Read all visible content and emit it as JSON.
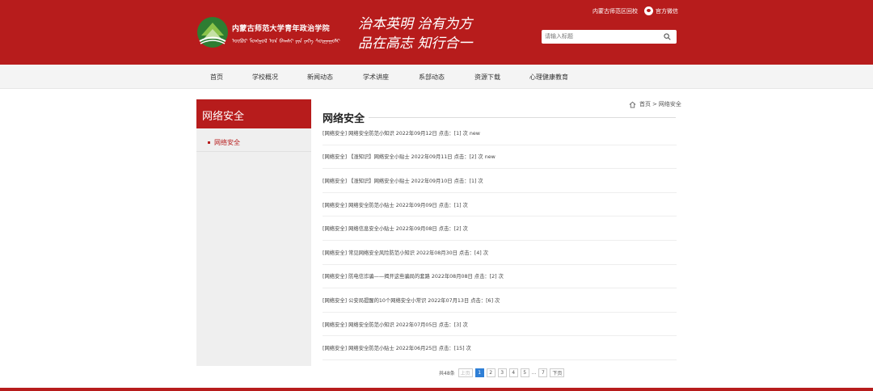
{
  "header": {
    "school_name_cn": "内蒙古师范大学青年政治学院",
    "school_name_mn": "ᠥᠪᠥᠷ ᠮᠣᠩᠭᠣᠯ ᠤᠨ ᠪᠠᠭᠰᠢ ᠶᠢᠨ ᠶᠡᠬᠡ ᠰᠤᠷᠭᠠᠭᠤᠯᠢ",
    "motto_line1": "治本英明 治有为方",
    "motto_line2": "品在高志 知行合一",
    "top_link": "内蒙古师范区回校",
    "wechat_label": "官方微信",
    "search_placeholder": "请输入标题"
  },
  "nav": {
    "items": [
      "首页",
      "学校概况",
      "新闻动态",
      "学术讲座",
      "系部动态",
      "资源下载",
      "心理健康教育"
    ]
  },
  "sidebar": {
    "title": "网络安全",
    "items": [
      "网络安全"
    ]
  },
  "breadcrumb": {
    "home": "首页",
    "sep": ">",
    "current": "网络安全"
  },
  "main": {
    "title": "网络安全",
    "articles": [
      "[网络安全] 网络安全防范小知识  2022年09月12日  点击：[1] 次 new",
      "[网络安全] 【涨知识】网络安全小贴士  2022年09月11日  点击：[2] 次 new",
      "[网络安全] 【涨知识】网络安全小贴士  2022年09月10日  点击：[1] 次",
      "[网络安全] 网络安全防范小贴士  2022年09月09日  点击：[1] 次",
      "[网络安全] 网络信息安全小贴士  2022年09月08日  点击：[2] 次",
      "[网络安全] 常见网络安全风险防范小知识  2022年08月30日  点击：[4] 次",
      "[网络安全] 防电信诈骗——揭开这些骗局的套路  2022年08月08日  点击：[2] 次",
      "[网络安全] 公安局提醒的10个网络安全小常识  2022年07月13日  点击：[6] 次",
      "[网络安全] 网络安全防范小知识  2022年07月05日  点击：[3] 次",
      "[网络安全] 网络安全防范小贴士  2022年06月25日  点击：[15] 次"
    ]
  },
  "pagination": {
    "total_label": "共48条",
    "prev": "上页",
    "pages": [
      "1",
      "2",
      "3",
      "4",
      "5"
    ],
    "ellipsis": "...",
    "last": "7",
    "next": "下页",
    "current_page": "1"
  },
  "colors": {
    "brand_red": "#b71c1c",
    "active_blue": "#2f7fd6"
  },
  "icons": [
    "logo-icon",
    "wechat-icon",
    "search-icon",
    "home-icon"
  ]
}
